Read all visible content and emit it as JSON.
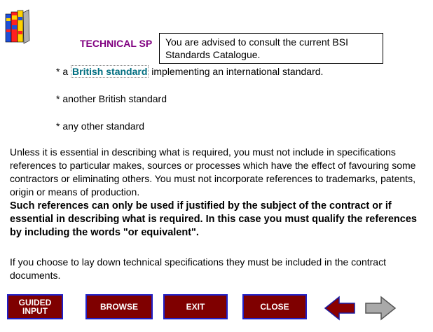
{
  "header": {
    "title": "TECHNICAL SP"
  },
  "tooltip": {
    "line1": "You are advised to consult the current BSI",
    "line2": "Standards Catalogue."
  },
  "bullets": {
    "b1_prefix": "* a ",
    "b1_link": "British standard",
    "b1_suffix": " implementing an international standard.",
    "b2": "* another British standard",
    "b3": "* any other standard"
  },
  "body": {
    "para1": "Unless it is essential in describing what is required, you must not include in specifications references to particular makes, sources or processes which have the effect of favouring some contractors or eliminating others. You must not incorporate references to trademarks, patents, origin or means of production.",
    "para2": "Such references can only be used if justified by the subject of the contract or if essential in describing what is required. In this case you must qualify the references by including the words \"or equivalent\".",
    "para3": "If you choose to lay down technical specifications they must be included in the contract documents."
  },
  "nav": {
    "guided_line1": "GUIDED",
    "guided_line2": "INPUT",
    "browse": "BROWSE",
    "exit": "EXIT",
    "close": "CLOSE",
    "back_icon": "left-arrow-icon",
    "next_icon": "right-arrow-icon",
    "back_color": "#8b0000",
    "next_color": "#a9a9a9"
  },
  "colors": {
    "title": "#800080",
    "link": "#006e80",
    "button_bg": "#7f0000",
    "button_border": "#2020c8"
  }
}
